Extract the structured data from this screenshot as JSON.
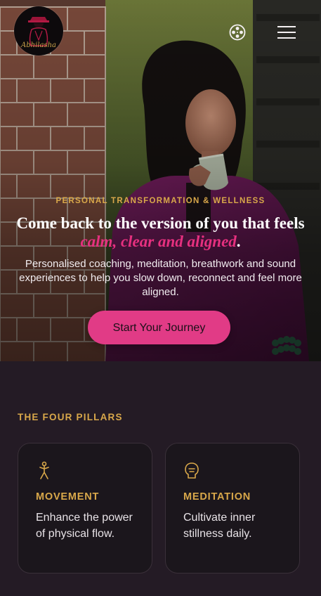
{
  "header": {
    "logo_text": "Abhilasha",
    "reel_icon": "film-reel-icon",
    "menu_icon": "hamburger-menu-icon"
  },
  "hero": {
    "eyebrow": "PERSONAL TRANSFORMATION & WELLNESS",
    "headline_line1": "Come back to the version of you that feels",
    "headline_accent": "calm, clear and aligned",
    "headline_period": ".",
    "subtext": "Personalised coaching, meditation, breathwork and sound experiences to help you slow down, reconnect and feel more aligned.",
    "cta_label": "Start Your Journey"
  },
  "pillars": {
    "section_title": "THE FOUR PILLARS",
    "cards": [
      {
        "icon": "movement-figure-icon",
        "title": "MOVEMENT",
        "description": "Enhance the power of physical flow."
      },
      {
        "icon": "meditation-head-icon",
        "title": "MEDITATION",
        "description": "Cultivate inner stillness daily."
      }
    ]
  },
  "colors": {
    "accent_pink": "#e13b86",
    "accent_gold": "#d9a84a",
    "page_bg": "#241b25",
    "card_bg": "#1b161c"
  }
}
